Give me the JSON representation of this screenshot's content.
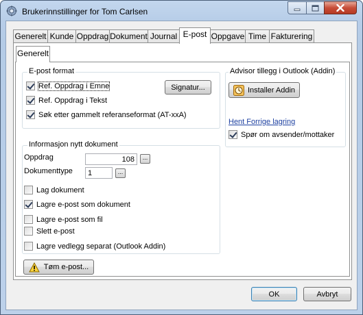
{
  "window": {
    "title": "Brukerinnstillinger for Tom Carlsen"
  },
  "tabs": [
    {
      "label": "Generelt"
    },
    {
      "label": "Kunde"
    },
    {
      "label": "Oppdrag"
    },
    {
      "label": "Dokument"
    },
    {
      "label": "Journal"
    },
    {
      "label": "E-post",
      "active": true
    },
    {
      "label": "Oppgave"
    },
    {
      "label": "Time"
    },
    {
      "label": "Fakturering"
    }
  ],
  "subtab": {
    "label": "Generelt"
  },
  "email_format": {
    "legend": "E-post format",
    "options": [
      {
        "label": "Ref. Oppdrag i Emne",
        "checked": true
      },
      {
        "label": "Ref. Oppdrag i Tekst",
        "checked": true
      },
      {
        "label": "Søk etter gammelt referanseformat (AT-xxA)",
        "checked": true
      }
    ],
    "signature_button": "Signatur..."
  },
  "addin": {
    "legend": "Advisor tillegg i Outlook (Addin)",
    "install_button": "Installer Addin",
    "fetch_heading": "Hent Forrige lagring",
    "ask_option": {
      "label": "Spør om avsender/mottaker",
      "checked": true
    }
  },
  "new_document": {
    "legend": "Informasjon nytt dokument",
    "assignment_label": "Oppdrag",
    "assignment_value": "108",
    "doctype_label": "Dokumenttype",
    "doctype_value": "1",
    "ellipsis": "...",
    "options": [
      {
        "label": "Lag dokument",
        "checked": false
      },
      {
        "label": "Lagre e-post som dokument",
        "checked": true
      },
      {
        "label": "Lagre e-post som fil",
        "checked": false
      },
      {
        "label": "Slett e-post",
        "checked": false
      },
      {
        "label": "Lagre vedlegg separat (Outlook Addin)",
        "checked": false
      }
    ]
  },
  "empty_button": "Tøm e-post...",
  "footer": {
    "ok": "OK",
    "cancel": "Avbryt"
  },
  "colors": {
    "title_bar": "#b9cfe9",
    "close_button": "#c74d38",
    "link_blue": "#1c3fa0",
    "client_bg": "#f0f0f0"
  }
}
